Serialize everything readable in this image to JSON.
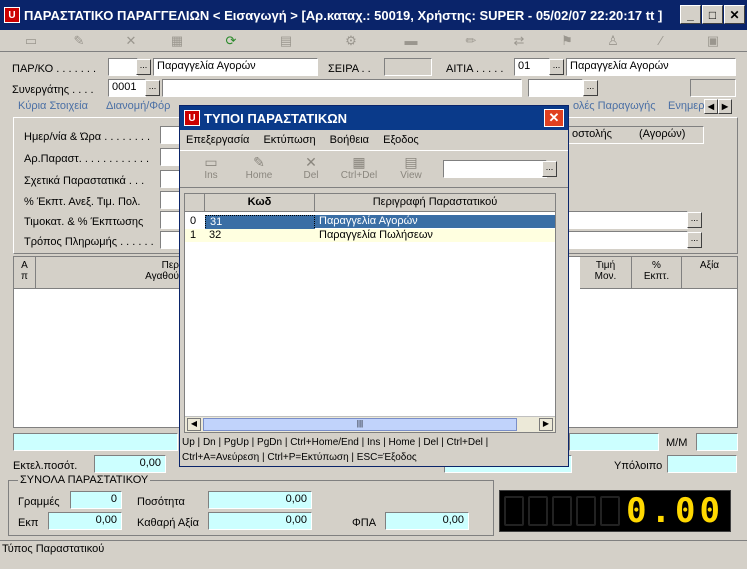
{
  "window": {
    "title": "ΠΑΡΑΣΤΑΤΙΚΟ ΠΑΡΑΓΓΕΛΙΩΝ < Εισαγωγή > [Αρ.καταχ.: 50019, Χρήστης: SUPER - 05/02/07 22:20:17 tt ]",
    "min": "_",
    "max": "□",
    "close": "✕"
  },
  "logo": "U",
  "header": {
    "parko_label": "ΠΑΡ/ΚΟ . . . . . . .",
    "parko_desc": "Παραγγελία Αγορών",
    "seira_label": "ΣΕΙΡΑ . .",
    "aitia_label": "ΑΙΤΙΑ . . . . .",
    "aitia_code": "01",
    "aitia_desc": "Παραγγελία Αγορών",
    "synergatis_label": "Συνεργάτης . . . .",
    "synergatis_code": "0001"
  },
  "tabs": {
    "main": "Κύρια Στοιχεία",
    "second": "Διανομή/Φόρ",
    "third": "ολές Παραγωγής",
    "fourth": "Ενημερ"
  },
  "left_fields": [
    "Ημερ/νία & Ώρα . . . . . . . .",
    "Αρ.Παραστ. . . . . . . . . . . .",
    "Σχετικά Παραστατικά . . .",
    "% Έκπτ. Ανεξ. Τιμ. Πολ.",
    "Τιμοκατ. & % Έκπτωσης",
    "Τρόπος Πληρωμής . . . . . ."
  ],
  "right_info": {
    "a": "οστολής",
    "b": "(Αγορών)"
  },
  "grid": {
    "col_a": "Α\nπ",
    "col_per": "Περ\nΑγαθού",
    "col_price": "Τιμή\nΜον.",
    "col_disc": "%\nΕκπτ.",
    "col_value": "Αξία"
  },
  "mm_label": "Μ/Μ",
  "ektel_label": "Εκτελ.ποσότ.",
  "ektel_value": "0,00",
  "ypoloipo_label": "Υπόλοιπο",
  "totals": {
    "legend": "ΣΥΝΟΛΑ ΠΑΡΑΣΤΑΤΙΚΟΥ",
    "grammes_label": "Γραμμές",
    "grammes_value": "0",
    "posotita_label": "Ποσότητα",
    "posotita_value": "0,00",
    "ekp_label": "Εκπ",
    "ekp_value": "0,00",
    "kathari_label": "Καθαρή Αξία",
    "kathari_value": "0,00",
    "fpa_label": "ΦΠΑ",
    "fpa_value": "0,00"
  },
  "display_value": "0.00",
  "status_text": "Τύπος Παραστατικού",
  "dialog": {
    "title": "ΤΥΠΟΙ ΠΑΡΑΣΤΑΤΙΚΩΝ",
    "menu": [
      "Επεξεργασία",
      "Εκτύπωση",
      "Βοήθεια",
      "Εξοδος"
    ],
    "tools": [
      {
        "label": "Ins",
        "icon": "new-doc-icon"
      },
      {
        "label": "Home",
        "icon": "home-icon"
      },
      {
        "label": "Del",
        "icon": "delete-icon"
      },
      {
        "label": "Ctrl+Del",
        "icon": "clear-icon"
      },
      {
        "label": "View",
        "icon": "view-icon"
      }
    ],
    "col_code": "Κωδ",
    "col_desc": "Περιγραφή Παραστατικού",
    "rows": [
      {
        "idx": "0",
        "code": "31",
        "desc": "Παραγγελία Αγορών"
      },
      {
        "idx": "1",
        "code": "32",
        "desc": "Παραγγελία Πωλήσεων"
      }
    ],
    "hints1": "Up | Dn | PgUp | PgDn | Ctrl+Home/End | Ins | Home | Del | Ctrl+Del |",
    "hints2": "Ctrl+A=Ανεύρεση | Ctrl+P=Εκτύπωση | ESC=Έξοδος"
  }
}
